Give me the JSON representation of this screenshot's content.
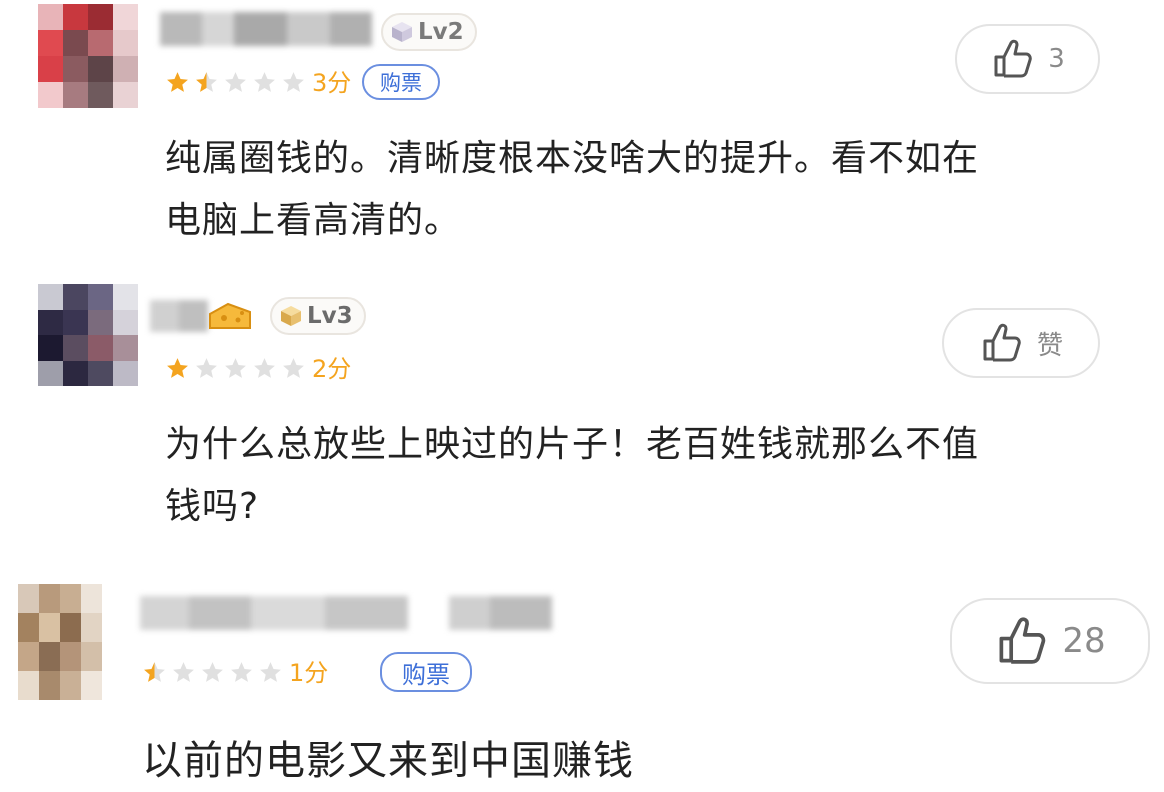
{
  "comments": [
    {
      "level": "Lv2",
      "rating_stars": 1.5,
      "score": "3分",
      "ticket_label": "购票",
      "like_count": "3",
      "text_lines": [
        "纯属圈钱的。清晰度根本没啥大的提升。看不如在",
        "电脑上看高清的。"
      ]
    },
    {
      "level": "Lv3",
      "rating_stars": 1,
      "score": "2分",
      "like_count": "赞",
      "text_lines": [
        "为什么总放些上映过的片子！老百姓钱就那么不值",
        "钱吗?"
      ]
    },
    {
      "rating_stars": 0.5,
      "score": "1分",
      "ticket_label": "购票",
      "like_count": "28",
      "text_lines": [
        "以前的电影又来到中国赚钱"
      ]
    }
  ],
  "colors": {
    "star_filled": "#f4a41f",
    "star_empty": "#e0e0e0",
    "ticket_border": "#6b8fe0",
    "ticket_text": "#3d6fd8",
    "like_border": "#e3e3e3"
  },
  "icons": {
    "like": "thumbs-up-icon",
    "star": "star-icon",
    "level": "cube-icon",
    "decoration": "cheese-icon"
  }
}
